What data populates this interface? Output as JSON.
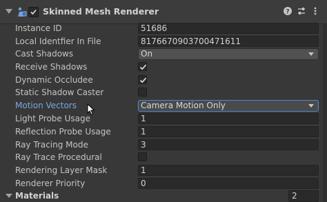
{
  "header": {
    "title": "Skinned Mesh Renderer",
    "enabled": true,
    "icons": [
      "fold-arrow-icon",
      "skinned-mesh-renderer-icon",
      "help-icon",
      "preset-icon",
      "more-options-icon"
    ]
  },
  "properties": [
    {
      "label": "Instance ID",
      "type": "text",
      "value": "51686"
    },
    {
      "label": "Local Identfier In File",
      "type": "text",
      "value": "8176670903700471611"
    },
    {
      "label": "Cast Shadows",
      "type": "dropdown",
      "value": "On"
    },
    {
      "label": "Receive Shadows",
      "type": "checkbox",
      "checked": true
    },
    {
      "label": "Dynamic Occludee",
      "type": "checkbox",
      "checked": true
    },
    {
      "label": "Static Shadow Caster",
      "type": "checkbox",
      "checked": false
    },
    {
      "label": "Motion Vectors",
      "type": "dropdown",
      "value": "Camera Motion Only"
    },
    {
      "label": "Light Probe Usage",
      "type": "text",
      "value": "1"
    },
    {
      "label": "Reflection Probe Usage",
      "type": "text",
      "value": "1"
    },
    {
      "label": "Ray Tracing Mode",
      "type": "text",
      "value": "3"
    },
    {
      "label": "Ray Trace Procedural",
      "type": "checkbox",
      "checked": false
    },
    {
      "label": "Rendering Layer Mask",
      "type": "text",
      "value": "1"
    },
    {
      "label": "Renderer Priority",
      "type": "text",
      "value": "0"
    }
  ],
  "materials": {
    "label": "Materials",
    "count": "2"
  },
  "colors": {
    "background": "#383838",
    "field": "#2a2a2a",
    "highlight_label": "#7ba7e0",
    "focus_border": "#4d8ad1"
  }
}
